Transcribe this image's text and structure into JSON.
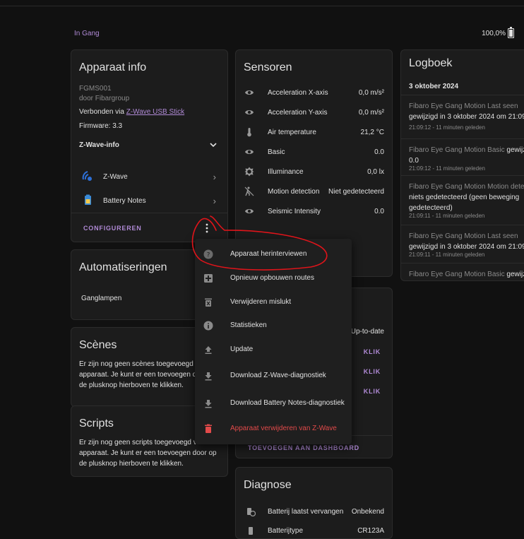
{
  "header": {
    "status": "In Gang",
    "battery": "100,0%",
    "battery_level": 100
  },
  "device_info": {
    "title": "Apparaat info",
    "model": "FGMS001",
    "manufacturer": "door Fibargroup",
    "connected_prefix": "Verbonden via ",
    "connected_link": "Z-Wave USB Stick",
    "firmware": "Firmware: 3.3",
    "zwave_info": "Z-Wave-info",
    "integrations": [
      "Z-Wave",
      "Battery Notes"
    ],
    "configure": "CONFIGUREREN"
  },
  "sensors": {
    "title": "Sensoren",
    "items": [
      {
        "name": "Acceleration X-axis",
        "value": "0,0 m/s²",
        "icon": "eye-icon"
      },
      {
        "name": "Acceleration Y-axis",
        "value": "0,0 m/s²",
        "icon": "eye-icon"
      },
      {
        "name": "Air temperature",
        "value": "21,2 °C",
        "icon": "thermometer-icon"
      },
      {
        "name": "Basic",
        "value": "0.0",
        "icon": "eye-icon"
      },
      {
        "name": "Illuminance",
        "value": "0,0 lx",
        "icon": "brightness-icon"
      },
      {
        "name": "Motion detection",
        "value": "Niet gedetecteerd",
        "icon": "motion-sensor-icon"
      },
      {
        "name": "Seismic Intensity",
        "value": "0.0",
        "icon": "eye-icon"
      }
    ]
  },
  "logbook": {
    "title": "Logboek",
    "date": "3 oktober 2024",
    "entries": [
      {
        "name": "Fibaro Eye Gang Motion Last seen",
        "text": "gewijzigd in 3 oktober 2024 om 21:09",
        "time": "21:09:12 - 11 minuten geleden"
      },
      {
        "name": "Fibaro Eye Gang Motion Basic",
        "action": "gewijzigd in",
        "text": "0.0",
        "time": "21:09:12 - 11 minuten geleden"
      },
      {
        "name": "Fibaro Eye Gang Motion Motion detection",
        "text": "niets gedetecteerd (geen beweging",
        "text2": "gedetecteerd)",
        "time": "21:09:11 - 11 minuten geleden"
      },
      {
        "name": "Fibaro Eye Gang Motion Last seen",
        "text": "gewijzigd in 3 oktober 2024 om 21:09",
        "time": "21:09:11 - 11 minuten geleden"
      },
      {
        "name": "Fibaro Eye Gang Motion Basic",
        "action": "gewijzigd in"
      }
    ]
  },
  "automations": {
    "title": "Automatiseringen",
    "item": "Ganglampen"
  },
  "scenes": {
    "title": "Scènes",
    "desc": "Er zijn nog geen scènes toegevoegd voor dit apparaat. Je kunt er een toevoegen door op de plusknop hierboven te klikken."
  },
  "scripts": {
    "title": "Scripts",
    "desc": "Er zijn nog geen scripts toegevoegd voor dit apparaat. Je kunt er een toevoegen door op de plusknop hierboven te klikken."
  },
  "controls": {
    "status": "Up-to-date",
    "klik": "KLIK",
    "add_dashboard": "TOEVOEGEN AAN DASHBOARD"
  },
  "diagnose": {
    "title": "Diagnose",
    "row1_name": "Batterij laatst vervangen",
    "row1_value": "Onbekend",
    "row2_name": "Batterijtype",
    "row2_value": "CR123A"
  },
  "menu": {
    "items": [
      {
        "label": "Apparaat herinterviewen",
        "icon": "help-circle-icon"
      },
      {
        "label": "Opnieuw opbouwen routes",
        "icon": "medical-bag-icon"
      },
      {
        "label": "Verwijderen mislukt",
        "icon": "delete-alert-icon"
      },
      {
        "label": "Statistieken",
        "icon": "info-icon"
      },
      {
        "label": "Update",
        "icon": "upload-icon"
      },
      {
        "label": "Download Z-Wave-diagnostiek",
        "icon": "download-icon"
      },
      {
        "label": "Download Battery Notes-diagnostiek",
        "icon": "download-icon"
      },
      {
        "label": "Apparaat verwijderen van Z-Wave",
        "icon": "trash-icon"
      }
    ]
  },
  "colors": {
    "accent": "#b08ad6",
    "danger": "#e24a4a",
    "annotation": "#e0141a",
    "background": "#111111",
    "card": "#1c1c1c"
  }
}
